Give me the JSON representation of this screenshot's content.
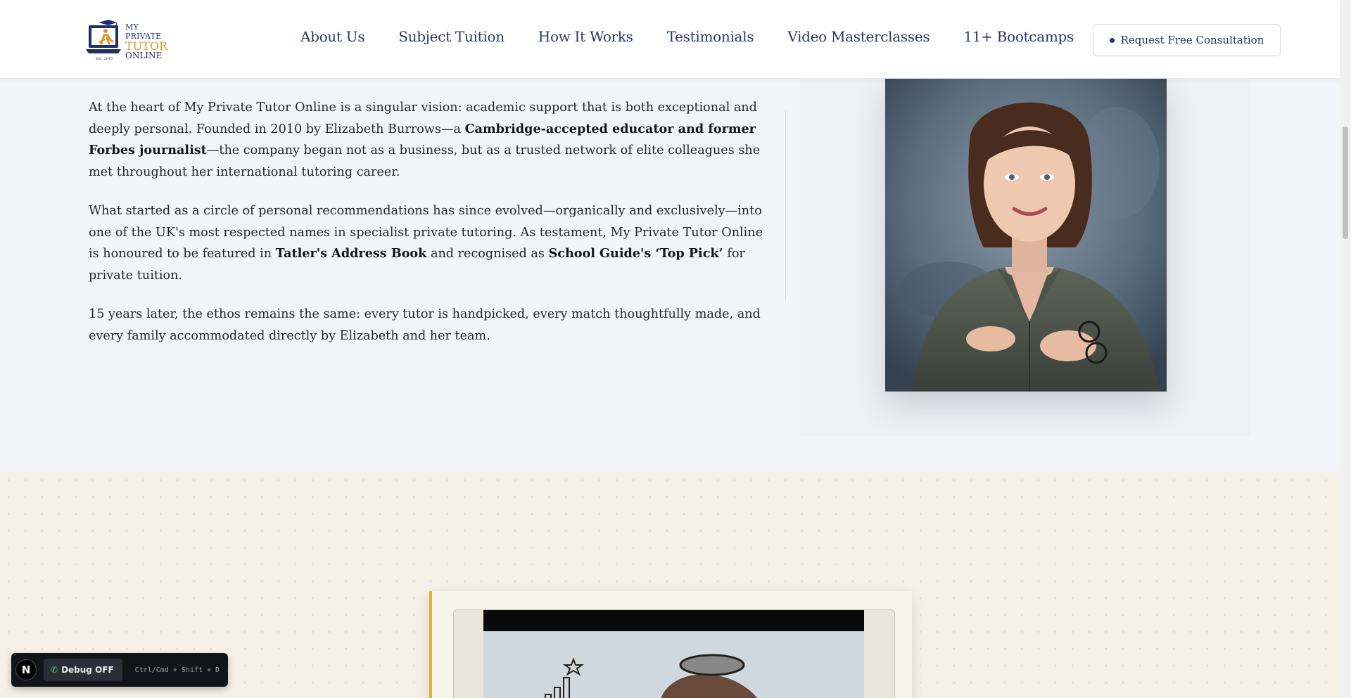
{
  "header": {
    "logo": {
      "line1": "MY PRIVATE",
      "line2": "TUTOR",
      "line3": "ONLINE",
      "est": "Est. 2010"
    },
    "nav": [
      {
        "label": "About Us"
      },
      {
        "label": "Subject Tuition"
      },
      {
        "label": "How It Works"
      },
      {
        "label": "Testimonials"
      },
      {
        "label": "Video Masterclasses"
      },
      {
        "label": "11+ Bootcamps"
      }
    ],
    "cta_label": "Request Free Consultation"
  },
  "about": {
    "p1": {
      "a": "At the heart of My Private Tutor Online is a singular vision: academic support that is both exceptional and deeply personal. Founded in 2010 by Elizabeth Burrows—a ",
      "b": "Cambridge-accepted educator and former Forbes journalist",
      "c": "—the company began not as a business, but as a trusted network of elite colleagues she met throughout her international tutoring career."
    },
    "p2": {
      "a": "What started as a circle of personal recommendations has since evolved—organically and exclusively—into one of the UK's most respected names in specialist private tutoring. As testament, My Private Tutor Online is honoured to be featured in ",
      "b": "Tatler's Address Book",
      "c": " and recognised as ",
      "d": "School Guide's ‘Top Pick’",
      "e": " for private tuition."
    },
    "p3": "15 years later, the ethos remains the same: every tutor is handpicked, every match thoughtfully made, and every family accommodated directly by Elizabeth and her team."
  },
  "debug": {
    "badge": "N",
    "button_label": "Debug OFF",
    "shortcut": "Ctrl/Cmd + Shift + D"
  },
  "colors": {
    "brand_navy": "#2a3566",
    "brand_gold": "#d59a2a",
    "accent_gold_border": "#d9b43a"
  }
}
